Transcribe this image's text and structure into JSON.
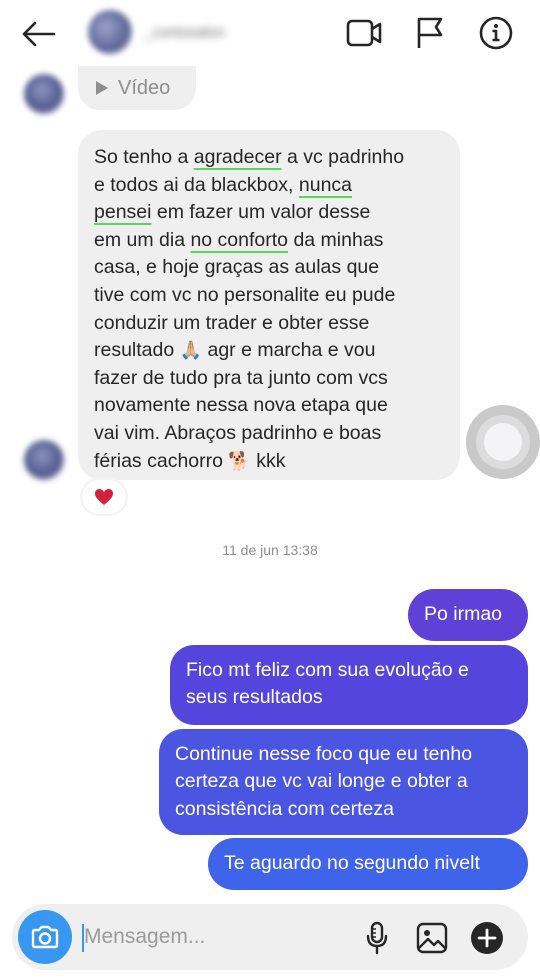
{
  "header": {
    "contact_name": "_contosalon",
    "icons": [
      "back-arrow-icon",
      "video-call-icon",
      "flag-icon",
      "info-icon"
    ]
  },
  "thread": {
    "video_label": "Vídeo",
    "incoming_lines": [
      [
        "So tenho a ",
        "agradecer",
        " a vc padrinho"
      ],
      [
        "e todos ai da blackbox, ",
        "nunca",
        ""
      ],
      [
        "",
        "pensei",
        " em fazer um valor desse"
      ],
      [
        "em um dia ",
        "no conforto",
        " da minhas"
      ],
      [
        "casa, e hoje graças as aulas que"
      ],
      [
        "tive com vc no personalite eu pude"
      ],
      [
        "conduzir um trader e obter esse"
      ],
      [
        "resultado ",
        "🙏🏼",
        " agr e marcha e vou"
      ],
      [
        "fazer de tudo pra ta junto com vcs"
      ],
      [
        "novamente nessa nova etapa que"
      ],
      [
        "vai vim. Abraços padrinho e boas"
      ],
      [
        "férias cachorro ",
        "🐕",
        " kkk"
      ]
    ],
    "reaction": "❤",
    "timestamp": "11 de jun 13:38",
    "outgoing": [
      [
        "Po irmao"
      ],
      [
        "Fico mt feliz com sua evolução e",
        "seus resultados"
      ],
      [
        "Continue nesse foco que eu tenho",
        "certeza que vc vai longe e obter a",
        "consistência com certeza"
      ],
      [
        "Te aguardo no segundo nivelt"
      ]
    ]
  },
  "composer": {
    "placeholder": "Mensagem...",
    "icons": [
      "camera-icon",
      "microphone-icon",
      "gallery-icon",
      "plus-icon"
    ]
  },
  "colors": {
    "incoming_bubble": "#efefef",
    "outgoing_gradient": [
      "#5f41d8",
      "#5446dc",
      "#4a56e2",
      "#3f64ea"
    ],
    "highlight_underline": "#5bd65b",
    "camera_button": "#3897f0"
  }
}
